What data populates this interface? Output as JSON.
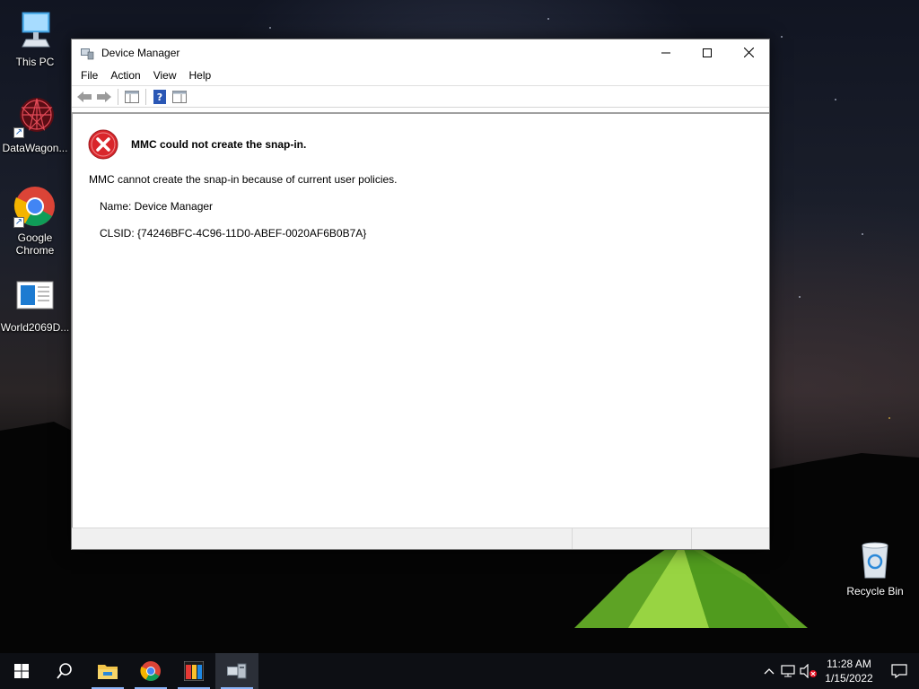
{
  "desktop": {
    "icons": [
      {
        "label": "This PC",
        "icon": "computer-icon"
      },
      {
        "label": "DataWagon...",
        "icon": "datawagon-icon"
      },
      {
        "label": "Google Chrome",
        "icon": "chrome-icon"
      },
      {
        "label": "World2069D...",
        "icon": "document-icon"
      },
      {
        "label": "Recycle Bin",
        "icon": "recycle-bin-icon"
      }
    ]
  },
  "window": {
    "title": "Device Manager",
    "controls": {
      "minimize": "minimize-icon",
      "maximize": "maximize-icon",
      "close": "close-icon"
    },
    "menu": [
      "File",
      "Action",
      "View",
      "Help"
    ],
    "toolbar": [
      "back-icon",
      "forward-icon",
      "show-hide-console-tree-icon",
      "help-icon",
      "show-hide-action-pane-icon"
    ],
    "error": {
      "title": "MMC could not create the snap-in.",
      "message": "MMC cannot create the snap-in because of current user policies.",
      "name_line": "Name: Device Manager",
      "clsid_line": "CLSID: {74246BFC-4C96-11D0-ABEF-0020AF6B0B7A}"
    }
  },
  "taskbar": {
    "apps": [
      "start-icon",
      "search-icon",
      "file-explorer-icon",
      "chrome-icon",
      "app-icon",
      "device-manager-icon"
    ],
    "clock": {
      "time": "11:28 AM",
      "date": "1/15/2022"
    },
    "tray": [
      "chevron-up-icon",
      "network-icon",
      "volume-muted-icon",
      "notification-icon"
    ]
  },
  "colors": {
    "accent": "#8ab4f8",
    "error_red": "#d9262b",
    "taskbar": "#0d0f14"
  }
}
